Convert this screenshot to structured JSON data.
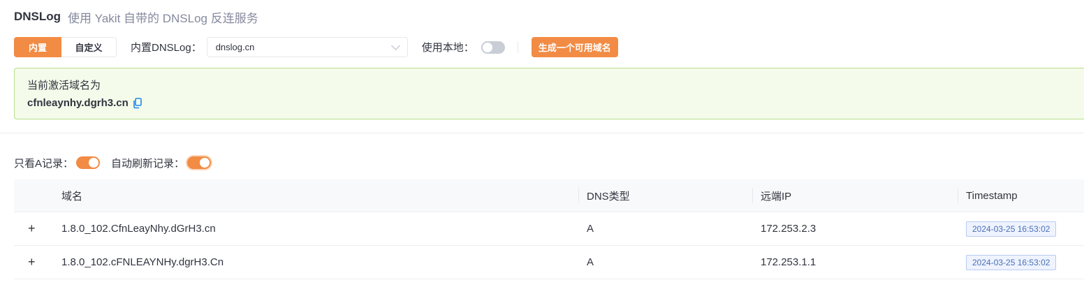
{
  "header": {
    "title": "DNSLog",
    "subtitle": "使用 Yakit 自带的 DNSLog 反连服务"
  },
  "controls": {
    "mode_builtin": "内置",
    "mode_custom": "自定义",
    "builtin_label": "内置DNSLog：",
    "builtin_value": "dnslog.cn",
    "use_local_label": "使用本地：",
    "use_local_enabled": false,
    "generate_button": "生成一个可用域名"
  },
  "active": {
    "label": "当前激活域名为",
    "domain": "cfnleaynhy.dgrh3.cn"
  },
  "filters": {
    "only_a_label": "只看A记录：",
    "only_a_enabled": true,
    "auto_refresh_label": "自动刷新记录：",
    "auto_refresh_enabled": true
  },
  "table": {
    "columns": [
      "域名",
      "DNS类型",
      "远端IP",
      "Timestamp"
    ],
    "rows": [
      {
        "expand": "+",
        "domain": "1.8.0_102.CfnLeayNhy.dGrH3.cn",
        "type": "A",
        "ip": "172.253.2.3",
        "timestamp": "2024-03-25 16:53:02"
      },
      {
        "expand": "+",
        "domain": "1.8.0_102.cFNLEAYNHy.dgrH3.Cn",
        "type": "A",
        "ip": "172.253.1.1",
        "timestamp": "2024-03-25 16:53:02"
      }
    ]
  },
  "colors": {
    "accent": "#f28b44",
    "success_bg": "#f4fbea",
    "success_border": "#b7e08a",
    "link_blue": "#1e88e5"
  },
  "icons": {
    "copy": "copy-icon",
    "select_arrow": "chevron-down-icon",
    "row_expand": "plus-icon"
  }
}
